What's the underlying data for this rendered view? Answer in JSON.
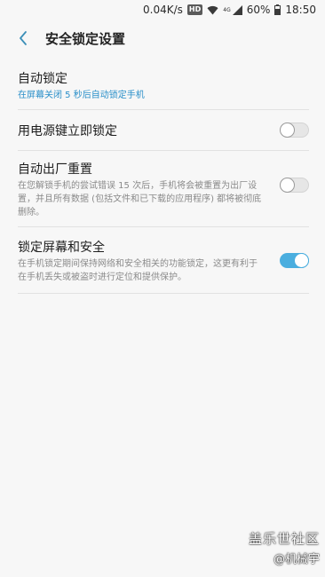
{
  "status_bar": {
    "speed": "0.04K/s",
    "hd": "HD",
    "network": "4G",
    "battery": "60%",
    "time": "18:50"
  },
  "header": {
    "title": "安全锁定设置"
  },
  "settings": {
    "auto_lock": {
      "title": "自动锁定",
      "subtitle": "在屏幕关闭 5 秒后自动锁定手机"
    },
    "power_key_lock": {
      "title": "用电源键立即锁定",
      "enabled": false
    },
    "factory_reset": {
      "title": "自动出厂重置",
      "subtitle": "在您解锁手机的尝试错误 15 次后，手机将会被重置为出厂设置，并且所有数据 (包括文件和已下载的应用程序) 都将被彻底删除。",
      "enabled": false
    },
    "lock_screen_security": {
      "title": "锁定屏幕和安全",
      "subtitle": "在手机锁定期间保持网络和安全相关的功能锁定，这更有利于在手机丢失或被盗时进行定位和提供保护。",
      "enabled": true
    }
  },
  "watermark": {
    "line1": "盖乐世社区",
    "line2": "@机械宇"
  },
  "colors": {
    "accent": "#4aaedf",
    "subtitle_accent": "#2a8fc9"
  }
}
